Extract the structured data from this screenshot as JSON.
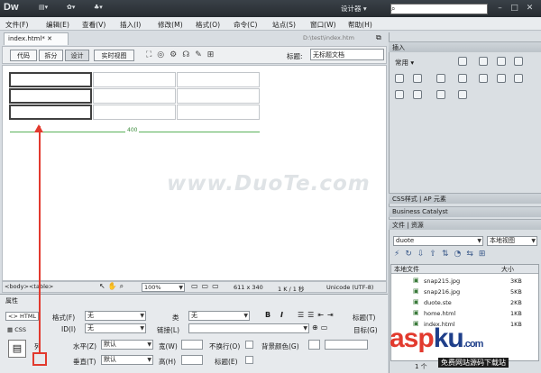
{
  "app": {
    "logo": "Dw",
    "designer": "设计器",
    "toolbar_icons": [
      "layout-icon",
      "extend-icon",
      "site-icon"
    ]
  },
  "menus": [
    "文件(F)",
    "编辑(E)",
    "查看(V)",
    "插入(I)",
    "修改(M)",
    "格式(O)",
    "命令(C)",
    "站点(S)",
    "窗口(W)",
    "帮助(H)"
  ],
  "document": {
    "tab": "index.html*",
    "path": "D:\\test\\index.htm"
  },
  "views": [
    "代码",
    "拆分",
    "设计",
    "实时视图"
  ],
  "title_label": "标题:",
  "title_value": "无标题文档",
  "table": {
    "width_label": "400"
  },
  "watermark": "www.DuoTe.com",
  "status": {
    "tags": "<body><table>",
    "zoom": "100%",
    "size": "611 x 340",
    "download": "1 K / 1 秒",
    "encoding": "Unicode (UTF-8)"
  },
  "properties": {
    "title": "属性",
    "html_tab": "HTML",
    "css_tab": "CSS",
    "format_label": "格式(F)",
    "format_value": "无",
    "class_label": "类",
    "class_value": "无",
    "id_label": "ID(I)",
    "id_value": "无",
    "link_label": "链接(L)",
    "title_label": "标题(T)",
    "target_label": "目标(G)",
    "row_label": "列",
    "halign_label": "水平(Z)",
    "halign_value": "默认",
    "valign_label": "垂直(T)",
    "valign_value": "默认",
    "width_label": "宽(W)",
    "height_label": "高(H)",
    "nowrap_label": "不换行(O)",
    "header_label": "标题(E)",
    "bg_label": "背景颜色(G)"
  },
  "panels": {
    "insert": "插入",
    "common": "常用",
    "css_tabs": [
      "CSS样式",
      "AP 元素"
    ],
    "bc": "Business Catalyst",
    "files_tabs": [
      "文件",
      "资源"
    ],
    "site": "duote",
    "view": "本地视图",
    "col_local": "本地文件",
    "col_size": "大小",
    "files": [
      {
        "name": "snap215.jpg",
        "size": "3KB"
      },
      {
        "name": "snap216.jpg",
        "size": "5KB"
      },
      {
        "name": "duote.ste",
        "size": "2KB"
      },
      {
        "name": "home.html",
        "size": "1KB"
      },
      {
        "name": "index.html",
        "size": "1KB"
      }
    ],
    "footer": "1 个"
  },
  "overlay": {
    "brand_red": "asp",
    "brand_blue": "ku",
    "brand_tail": ".com",
    "sub": "免费网站源码下载站"
  }
}
